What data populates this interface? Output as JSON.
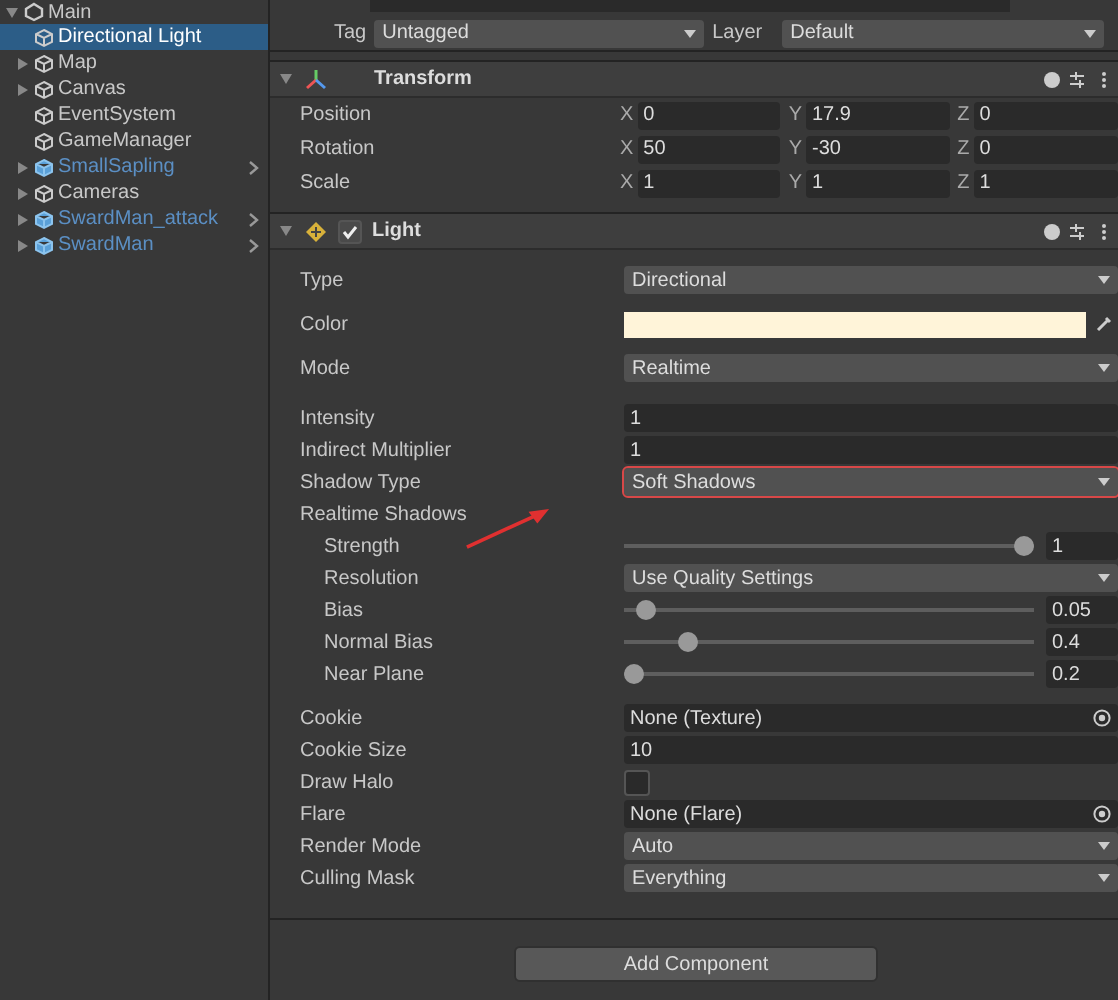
{
  "hierarchy": {
    "scene": {
      "label": "Main",
      "expanded": true,
      "children": [
        {
          "label": "Directional Light",
          "kind": "object",
          "selected": true
        },
        {
          "label": "Map",
          "kind": "object",
          "expanded": false,
          "selected": false
        },
        {
          "label": "Canvas",
          "kind": "object",
          "expanded": false,
          "selected": false
        },
        {
          "label": "EventSystem",
          "kind": "object",
          "selected": false
        },
        {
          "label": "GameManager",
          "kind": "object",
          "selected": false
        },
        {
          "label": "SmallSapling",
          "kind": "prefab",
          "expanded": false,
          "selected": false
        },
        {
          "label": "Cameras",
          "kind": "object",
          "expanded": false,
          "selected": false
        },
        {
          "label": "SwardMan_attack",
          "kind": "prefab",
          "expanded": false,
          "selected": false
        },
        {
          "label": "SwardMan",
          "kind": "prefab",
          "expanded": false,
          "selected": false
        }
      ]
    }
  },
  "inspector": {
    "tag": {
      "label": "Tag",
      "value": "Untagged"
    },
    "layer": {
      "label": "Layer",
      "value": "Default"
    },
    "transform": {
      "title": "Transform",
      "expanded": true,
      "rows": [
        {
          "label": "Position",
          "values": [
            {
              "axis": "X",
              "value": "0"
            },
            {
              "axis": "Y",
              "value": "17.9"
            },
            {
              "axis": "Z",
              "value": "0"
            }
          ]
        },
        {
          "label": "Rotation",
          "values": [
            {
              "axis": "X",
              "value": "50"
            },
            {
              "axis": "Y",
              "value": "-30"
            },
            {
              "axis": "Z",
              "value": "0"
            }
          ]
        },
        {
          "label": "Scale",
          "values": [
            {
              "axis": "X",
              "value": "1"
            },
            {
              "axis": "Y",
              "value": "1"
            },
            {
              "axis": "Z",
              "value": "1"
            }
          ]
        }
      ]
    },
    "light": {
      "title": "Light",
      "enabled": true,
      "expanded": true,
      "sections": [
        {
          "rows": [
            {
              "kind": "dropdown",
              "label": "Type",
              "value": "Directional"
            },
            {
              "kind": "color",
              "label": "Color",
              "color": "#fff4d9"
            },
            {
              "kind": "dropdown",
              "label": "Mode",
              "value": "Realtime"
            }
          ]
        },
        {
          "rows": [
            {
              "kind": "field",
              "label": "Intensity",
              "value": "1"
            },
            {
              "kind": "field",
              "label": "Indirect Multiplier",
              "value": "1"
            },
            {
              "kind": "dropdown",
              "label": "Shadow Type",
              "value": "Soft Shadows",
              "highlighted": true
            },
            {
              "kind": "header",
              "label": "Realtime Shadows",
              "children": [
                {
                  "kind": "slider",
                  "label": "Strength",
                  "level": 1,
                  "value": "1"
                },
                {
                  "kind": "dropdown",
                  "label": "Resolution",
                  "value": "Use Quality Settings"
                },
                {
                  "kind": "slider",
                  "label": "Bias",
                  "level": 0.03,
                  "value": "0.05"
                },
                {
                  "kind": "slider",
                  "label": "Normal Bias",
                  "level": 0.14,
                  "value": "0.4"
                },
                {
                  "kind": "slider",
                  "label": "Near Plane",
                  "level": 0,
                  "value": "0.2"
                }
              ]
            }
          ]
        },
        {
          "rows": [
            {
              "kind": "object",
              "label": "Cookie",
              "value": "None (Texture)"
            },
            {
              "kind": "field",
              "label": "Cookie Size",
              "value": "10"
            },
            {
              "kind": "checkbox",
              "label": "Draw Halo",
              "checked": false
            },
            {
              "kind": "object",
              "label": "Flare",
              "value": "None (Flare)"
            },
            {
              "kind": "dropdown",
              "label": "Render Mode",
              "value": "Auto"
            },
            {
              "kind": "dropdown",
              "label": "Culling Mask",
              "value": "Everything"
            }
          ]
        }
      ]
    },
    "add_component": "Add Component"
  }
}
